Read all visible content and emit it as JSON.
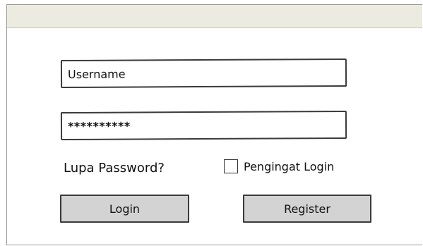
{
  "form": {
    "username_value": "Username",
    "password_value": "**********",
    "forgot_password_label": "Lupa Password?",
    "remember_label": "Pengingat Login",
    "remember_checked": false,
    "login_label": "Login",
    "register_label": "Register"
  },
  "colors": {
    "titlebar": "#ecebdf",
    "button_fill": "#d3d3d3",
    "border": "#3a3a3a"
  }
}
